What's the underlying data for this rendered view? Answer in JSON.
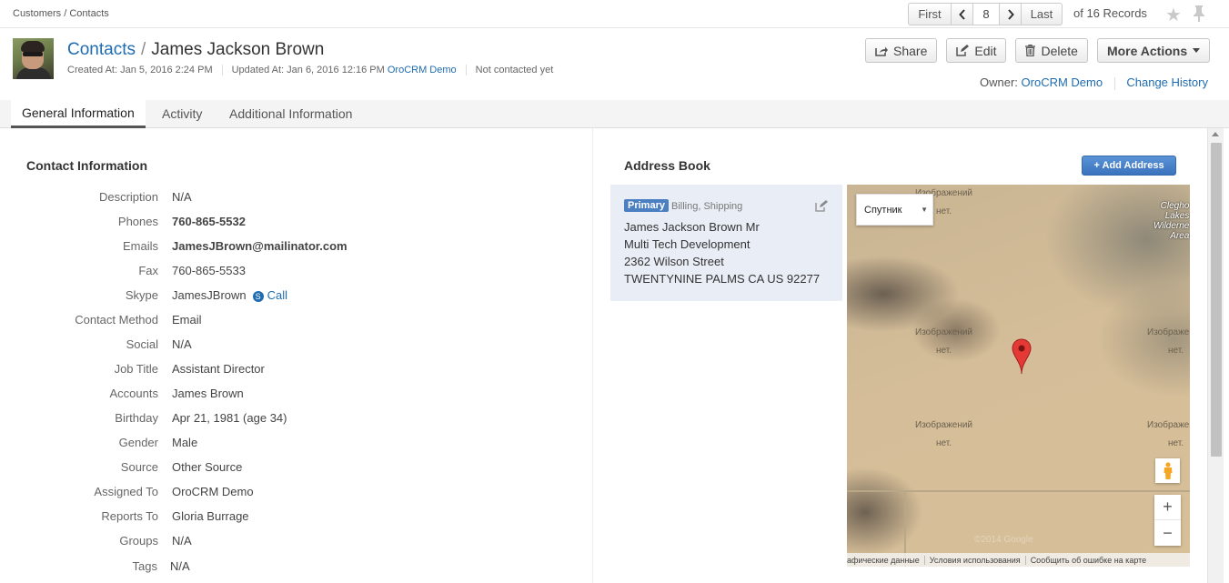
{
  "breadcrumb": "Customers / Contacts",
  "pager": {
    "first": "First",
    "current": "8",
    "last": "Last",
    "records": "of 16 Records",
    "prev_icon": "chevron-left-icon",
    "next_icon": "chevron-right-icon"
  },
  "header": {
    "crumb": "Contacts",
    "separator": "/",
    "name": "James Jackson Brown",
    "created": "Created At: Jan 5, 2016 2:24 PM",
    "updated_prefix": "Updated At: Jan 6, 2016 12:16 PM",
    "updated_by": "OroCRM Demo",
    "contacted": "Not contacted yet"
  },
  "actions": {
    "share": "Share",
    "edit": "Edit",
    "delete": "Delete",
    "more": "More Actions"
  },
  "owner": {
    "label": "Owner:",
    "value": "OroCRM Demo",
    "history": "Change History"
  },
  "tabs": [
    "General Information",
    "Activity",
    "Additional Information"
  ],
  "contact_info": {
    "title": "Contact Information",
    "rows": [
      {
        "label": "Description",
        "value": "N/A"
      },
      {
        "label": "Phones",
        "value": "760-865-5532"
      },
      {
        "label": "Emails",
        "value": "JamesJBrown@mailinator.com"
      },
      {
        "label": "Fax",
        "value": "760-865-5533"
      },
      {
        "label": "Skype",
        "value": "JamesJBrown",
        "extra": "Call"
      },
      {
        "label": "Contact Method",
        "value": "Email"
      },
      {
        "label": "Social",
        "value": "N/A"
      },
      {
        "label": "Job Title",
        "value": "Assistant Director"
      },
      {
        "label": "Accounts",
        "value": "James Brown"
      },
      {
        "label": "Birthday",
        "value": "Apr 21, 1981 (age 34)"
      },
      {
        "label": "Gender",
        "value": "Male"
      },
      {
        "label": "Source",
        "value": "Other Source"
      },
      {
        "label": "Assigned To",
        "value": "OroCRM Demo"
      },
      {
        "label": "Reports To",
        "value": "Gloria Burrage"
      },
      {
        "label": "Groups",
        "value": "N/A"
      },
      {
        "label": "Tags",
        "value": "N/A"
      }
    ]
  },
  "address_book": {
    "title": "Address Book",
    "add_button": "+ Add Address",
    "badge": "Primary",
    "types": "Billing, Shipping",
    "lines": [
      "James Jackson Brown Mr",
      "Multi Tech Development",
      "2362 Wilson Street",
      "TWENTYNINE PALMS CA US 92277"
    ]
  },
  "map": {
    "type_select": "Спутник",
    "no_image_line1": "Изображений",
    "no_image_line2": "нет.",
    "place_label": [
      "Clegho",
      "Lakes",
      "Wilderne",
      "Area"
    ],
    "footer": [
      "афические данные",
      "Условия использования",
      "Сообщить об ошибке на карте"
    ],
    "watermark": "©2014 Google"
  },
  "colors": {
    "link": "#1f6cb0",
    "primary_button": "#3a72bd",
    "address_card": "#e9eef6"
  }
}
